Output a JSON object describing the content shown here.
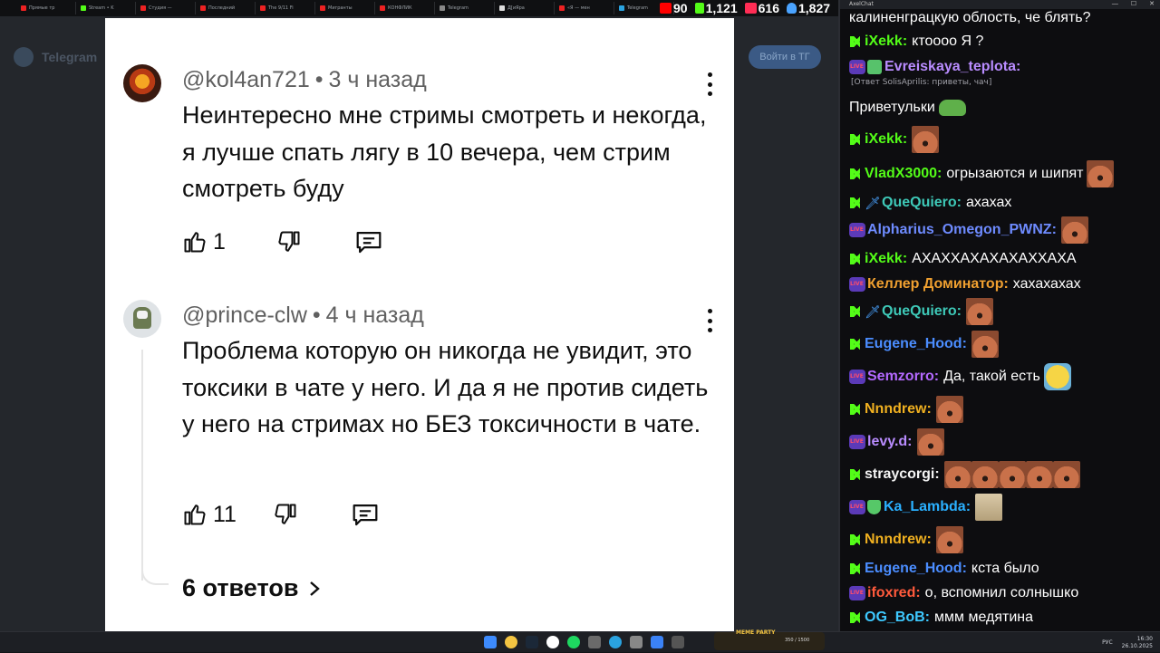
{
  "browser": {
    "tabs": [
      "Прямые тр",
      "Stream • K",
      "Студия —",
      "Последний",
      "The 9/11 Fi",
      "Мигранты",
      "КОНФЛИК",
      "Telegram",
      "Д[иЯра",
      "«Я — мен",
      "Telegram"
    ],
    "tab_colors": [
      "#e22",
      "#53fc18",
      "#e22",
      "#e22",
      "#e22",
      "#e22",
      "#e22",
      "#888",
      "#ddd",
      "#e22",
      "#2aa3e0"
    ]
  },
  "counters": {
    "youtube": "90",
    "kick": "1,121",
    "vk": "616",
    "total": "1,827"
  },
  "background_app": {
    "title": "Telegram",
    "button": "Войти в ТГ"
  },
  "comments": [
    {
      "author": "@kol4an721",
      "time": "3 ч назад",
      "text": "Неинтересно мне стримы смотреть и некогда, я лучше спать лягу в 10 вечера, чем стрим смотреть буду",
      "likes": "1"
    },
    {
      "author": "@prince-clw",
      "time": "4 ч назад",
      "text": "Проблема которую он никогда не увидит, это токсики в чате у него. И да я не против сидеть у него на стримах но БЕЗ токсичности в чате.",
      "likes": "11"
    }
  ],
  "replies_label": "6 ответов",
  "chat": {
    "window_title": "AxelChat",
    "messages": [
      {
        "text": "калиненграцкую облость, че блять?"
      },
      {
        "nick": "iXekk:",
        "color": "#53fc18",
        "text": "ктоооо Я ?"
      },
      {
        "nick": "Evreiskaya_teplota:",
        "color": "#b98cff",
        "text": ""
      },
      {
        "reply_context": "[Ответ SolisAprilis: приветы, чач]"
      },
      {
        "text": "Приветульки"
      },
      {
        "nick": "iXekk:",
        "color": "#53fc18",
        "text": ""
      },
      {
        "nick": "VladX3000:",
        "color": "#53fc18",
        "text": "огрызаются и шипят"
      },
      {
        "nick": "QueQuiero:",
        "color": "#3ec9b8",
        "text": "ахахах"
      },
      {
        "nick": "Alpharius_Omegon_PWNZ:",
        "color": "#6e8bff",
        "text": ""
      },
      {
        "nick": "iXekk:",
        "color": "#53fc18",
        "text": "АХАХХАХАХАХАХХАХА"
      },
      {
        "nick": "Келлер Доминатор:",
        "color": "#f0a030",
        "text": "хахахахах"
      },
      {
        "nick": "QueQuiero:",
        "color": "#3ec9b8",
        "text": ""
      },
      {
        "nick": "Eugene_Hood:",
        "color": "#4b8dff",
        "text": ""
      },
      {
        "nick": "Semzorro:",
        "color": "#b469ff",
        "text": "Да, такой есть"
      },
      {
        "nick": "Nnndrew:",
        "color": "#f0b020",
        "text": ""
      },
      {
        "nick": "levy.d:",
        "color": "#b98cff",
        "text": ""
      },
      {
        "nick": "straycorgi:",
        "color": "#f4f4f4",
        "text": ""
      },
      {
        "nick": "Ka_Lambda:",
        "color": "#2ab0ff",
        "text": ""
      },
      {
        "nick": "Nnndrew:",
        "color": "#f0b020",
        "text": ""
      },
      {
        "nick": "Eugene_Hood:",
        "color": "#4b8dff",
        "text": "кста было"
      },
      {
        "nick": "ifoxred:",
        "color": "#ff5a3c",
        "text": "о, вспомнил солнышко"
      },
      {
        "nick": "OG_BoB:",
        "color": "#3ec9ff",
        "text": "ммм медятина"
      }
    ]
  },
  "taskbar": {
    "meme_title": "MEME PARTY",
    "meme_count": "350 / 1500",
    "lang": "РУС",
    "time": "16:30",
    "date": "26.10.2025"
  }
}
